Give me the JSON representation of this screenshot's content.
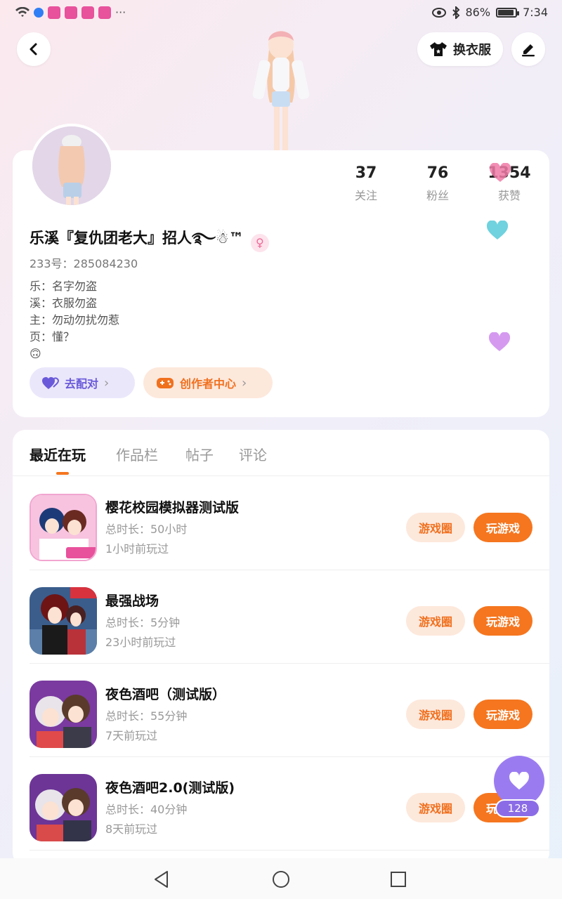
{
  "status_bar": {
    "battery": "86%",
    "battery_level": 0.86,
    "time": "7:34",
    "dots": "···"
  },
  "header": {
    "outfit_label": "换衣服"
  },
  "profile": {
    "stats": [
      {
        "num": "37",
        "label": "关注"
      },
      {
        "num": "76",
        "label": "粉丝"
      },
      {
        "num": "1354",
        "label": "获赞"
      }
    ],
    "username": "乐溪『复仇团老大』招人࿐☃︎™",
    "gender_symbol": "♀",
    "uid": "233号：285084230",
    "bio": [
      "乐：名字勿盗",
      "溪：衣服勿盗",
      "主：勿动勿扰勿惹",
      "页：懂？",
      "🙃"
    ],
    "match_label": "去配对",
    "creator_label": "创作者中心"
  },
  "tabs": [
    "最近在玩",
    "作品栏",
    "帖子",
    "评论"
  ],
  "games": [
    {
      "title": "樱花校园模拟器测试版",
      "duration": "总时长：50小时",
      "last": "1小时前玩过",
      "circle": "游戏圈",
      "play": "玩游戏"
    },
    {
      "title": "最强战场",
      "duration": "总时长：5分钟",
      "last": "23小时前玩过",
      "circle": "游戏圈",
      "play": "玩游戏"
    },
    {
      "title": "夜色酒吧（测试版）",
      "duration": "总时长：55分钟",
      "last": "7天前玩过",
      "circle": "游戏圈",
      "play": "玩游戏"
    },
    {
      "title": "夜色酒吧2.0(测试版)",
      "duration": "总时长：40分钟",
      "last": "8天前玩过",
      "circle": "游戏圈",
      "play": "玩游戏"
    }
  ],
  "float_like_count": "128",
  "colors": {
    "accent": "#f5761f",
    "purple": "#9b7cf0"
  }
}
